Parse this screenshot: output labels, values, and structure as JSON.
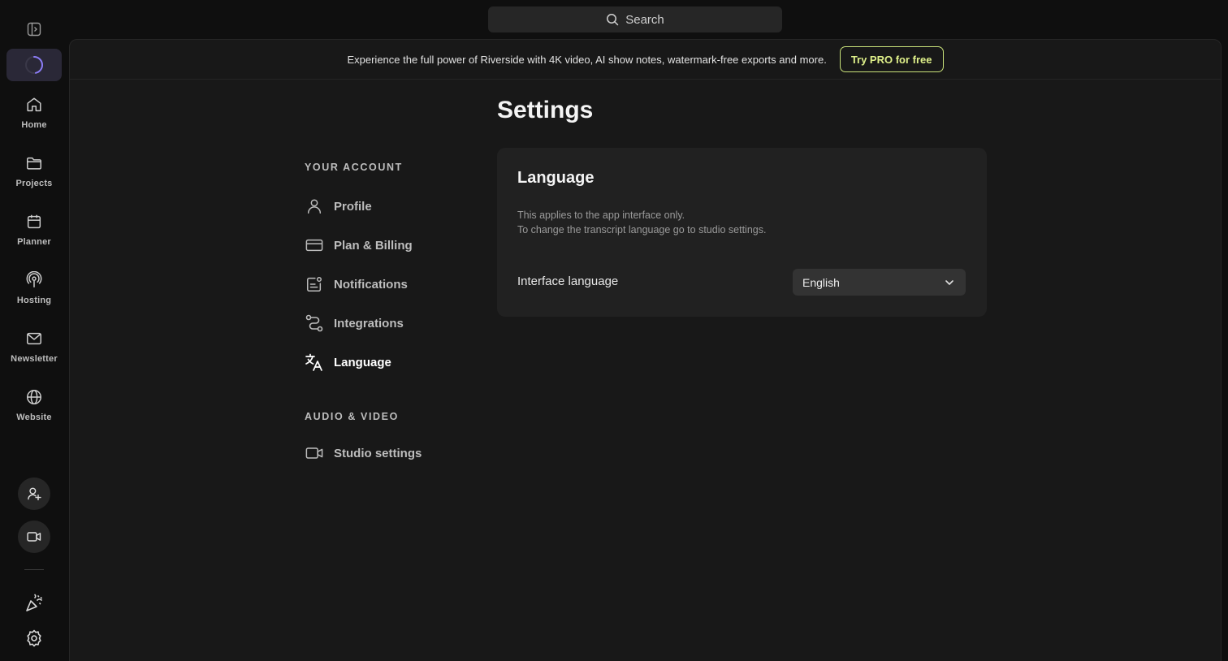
{
  "search": {
    "placeholder": "Search"
  },
  "rail": {
    "items": [
      {
        "label": "Home",
        "icon": "home-icon"
      },
      {
        "label": "Projects",
        "icon": "folder-icon"
      },
      {
        "label": "Planner",
        "icon": "calendar-icon"
      },
      {
        "label": "Hosting",
        "icon": "podcast-icon"
      },
      {
        "label": "Newsletter",
        "icon": "mail-icon"
      },
      {
        "label": "Website",
        "icon": "globe-icon"
      }
    ],
    "actions": [
      "add-user-icon",
      "video-camera-icon"
    ],
    "bottom": [
      "party-popper-icon",
      "gear-icon"
    ]
  },
  "banner": {
    "text": "Experience the full power of Riverside with 4K video, AI show notes, watermark-free exports and more.",
    "cta": "Try PRO for free"
  },
  "page": {
    "title": "Settings"
  },
  "settings_nav": {
    "account_section": "YOUR ACCOUNT",
    "account_items": [
      {
        "label": "Profile",
        "icon": "user-icon"
      },
      {
        "label": "Plan & Billing",
        "icon": "credit-card-icon"
      },
      {
        "label": "Notifications",
        "icon": "notification-icon"
      },
      {
        "label": "Integrations",
        "icon": "integrations-icon"
      },
      {
        "label": "Language",
        "icon": "translate-icon",
        "active": true
      }
    ],
    "av_section": "AUDIO & VIDEO",
    "av_items": [
      {
        "label": "Studio settings",
        "icon": "video-camera-icon"
      }
    ]
  },
  "language_card": {
    "title": "Language",
    "desc_line1": "This applies to the app interface only.",
    "desc_line2": "To change the transcript language go to studio settings.",
    "field_label": "Interface language",
    "selected": "English"
  },
  "colors": {
    "accent": "#dff08a",
    "active_bg": "#2a2837",
    "spinner": "#8b7cf6"
  }
}
